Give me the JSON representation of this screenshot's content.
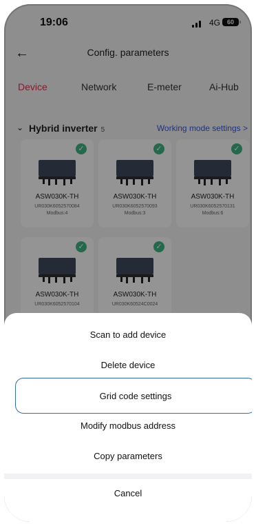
{
  "status": {
    "time": "19:06",
    "network": "4G",
    "battery": "60"
  },
  "nav": {
    "title": "Config. parameters"
  },
  "tabs": [
    "Device",
    "Network",
    "E-meter",
    "Ai-Hub"
  ],
  "section": {
    "title": "Hybrid inverter",
    "count": "5",
    "link": "Working mode settings >"
  },
  "devices": [
    {
      "model": "ASW030K-TH",
      "sn": "UR030K6052570084",
      "modbus": "Modbus:4"
    },
    {
      "model": "ASW030K-TH",
      "sn": "UR030K6052570093",
      "modbus": "Modbus:3"
    },
    {
      "model": "ASW030K-TH",
      "sn": "UR030K6052570131",
      "modbus": "Modbus:6"
    },
    {
      "model": "ASW030K-TH",
      "sn": "UR030K6052570104",
      "modbus": ""
    },
    {
      "model": "ASW030K-TH",
      "sn": "UR030K60524C0024",
      "modbus": ""
    }
  ],
  "sheet": {
    "items": [
      "Scan to add device",
      "Delete device",
      "Grid code settings",
      "Modify modbus address",
      "Copy parameters"
    ],
    "cancel": "Cancel"
  },
  "colors": {
    "accent": "#e3314a",
    "link": "#3a56d6",
    "check": "#3fb486",
    "highlight_border": "#2f6ea3"
  }
}
